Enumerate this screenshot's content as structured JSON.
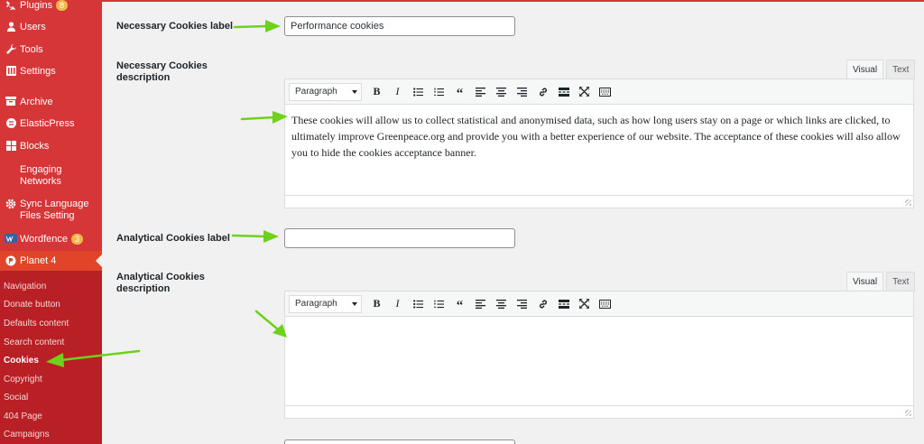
{
  "sidebar": {
    "items": [
      {
        "label": "Plugins",
        "badge": "8"
      },
      {
        "label": "Users"
      },
      {
        "label": "Tools"
      },
      {
        "label": "Settings"
      },
      {
        "label": "Archive"
      },
      {
        "label": "ElasticPress"
      },
      {
        "label": "Blocks"
      },
      {
        "label": "Engaging Networks"
      },
      {
        "label": "Sync Language Files Setting"
      },
      {
        "label": "Wordfence",
        "badge": "3"
      },
      {
        "label": "Planet 4"
      }
    ],
    "submenu": [
      "Navigation",
      "Donate button",
      "Defaults content",
      "Search content",
      "Cookies",
      "Copyright",
      "Social",
      "404 Page",
      "Campaigns"
    ]
  },
  "form": {
    "necessary_label": {
      "label": "Necessary Cookies label",
      "value": "Performance cookies"
    },
    "necessary_description": {
      "label": "Necessary Cookies description",
      "text": "These cookies will allow us to collect statistical and anonymised data, such as how long users stay on a page or which links are clicked, to ultimately improve Greenpeace.org and provide you with a better experience of our website. The acceptance of these cookies will also allow you to hide the cookies acceptance banner."
    },
    "analytical_label": {
      "label": "Analytical Cookies label",
      "value": ""
    },
    "analytical_description": {
      "label": "Analytical Cookies description",
      "text": ""
    }
  },
  "editor": {
    "tab_visual": "Visual",
    "tab_text": "Text",
    "format_select": "Paragraph",
    "buttons": [
      "bold",
      "italic",
      "bulleted-list",
      "numbered-list",
      "blockquote",
      "align-left",
      "align-center",
      "align-right",
      "link",
      "read-more",
      "fullscreen",
      "toolbar-toggle"
    ]
  },
  "colors": {
    "sidebar_bg": "#d63638",
    "submenu_bg": "#b82025",
    "current_item_bg": "#e0452a",
    "arrow": "#6ed21a",
    "badge": "#f0b849"
  }
}
